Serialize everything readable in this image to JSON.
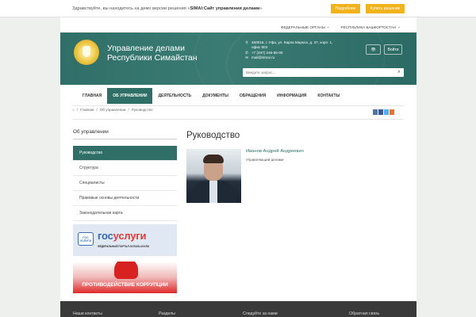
{
  "demo": {
    "text_prefix": "Здравствуйте, вы находитесь на демо версии решения «",
    "text_product": "SIMAI:Сайт управления делами",
    "text_suffix": "»",
    "more_button": "Подробнее",
    "buy_button": "Купить решение"
  },
  "toplinks": [
    {
      "label": "ФЕДЕРАЛЬНЫЕ ОРГАНЫ",
      "icon": "chevron-down-icon"
    },
    {
      "label": "РЕСПУБЛИКА БАШКОРТОСТАН",
      "icon": "chevron-down-icon"
    }
  ],
  "header": {
    "brand_line1": "Управление делами",
    "brand_line2": "Республики Симайстан",
    "address_line1": "450015, г. Уфа, ул. Карла Маркса, д. 37, корп. 1,",
    "address_line2": "офис 503",
    "phone": "+7 (347) 246-65-00",
    "email": "mail@simai.ru",
    "eye_button_icon": "eye-icon",
    "login_button": "Войти",
    "search_placeholder": "Введите запрос...",
    "search_icon": "search-icon"
  },
  "nav": [
    {
      "label": "ГЛАВНАЯ",
      "active": false
    },
    {
      "label": "ОБ УПРАВЛЕНИИ",
      "active": true
    },
    {
      "label": "ДЕЯТЕЛЬНОСТЬ",
      "active": false
    },
    {
      "label": "ДОКУМЕНТЫ",
      "active": false
    },
    {
      "label": "ОБРАЩЕНИЯ",
      "active": false
    },
    {
      "label": "ИНФОРМАЦИЯ",
      "active": false
    },
    {
      "label": "КОНТАКТЫ",
      "active": false
    }
  ],
  "breadcrumb": [
    {
      "label": "Главная"
    },
    {
      "label": "Об управлении"
    },
    {
      "label": "Руководство"
    }
  ],
  "share_colors": [
    "#4c75a3",
    "#3b5998",
    "#55acee",
    "#eb722e"
  ],
  "sidebar": {
    "title": "Об управлении",
    "items": [
      {
        "label": "Руководство",
        "active": true
      },
      {
        "label": "Структура",
        "active": false
      },
      {
        "label": "Специалисты",
        "active": false
      },
      {
        "label": "Правовые основы деятельности",
        "active": false
      },
      {
        "label": "Законодательная карта",
        "active": false
      }
    ]
  },
  "banners": {
    "gos_badge": "ГОС УСЛУГИ",
    "gos_logo_part1": "гос",
    "gos_logo_part2": "услуги",
    "gos_sub": "ФЕДЕРАЛЬНЫЙ ПОРТАЛ GOSUSLUGI.RU",
    "anti_corruption": "ПРОТИВОДЕЙСТВИЕ КОРРУПЦИИ"
  },
  "main": {
    "title": "Руководство",
    "person_name": "Иванов Андрей Андреевич",
    "person_position": "Управляющий делами"
  },
  "footer": {
    "col1": "Наши контакты",
    "col2": "Разделы",
    "col3": "Следуйте за нами",
    "col4": "Обратная связь"
  },
  "colors": {
    "accent": "#2f6f68",
    "demo_button": "#f2b21a",
    "footer": "#3a3a3a"
  }
}
